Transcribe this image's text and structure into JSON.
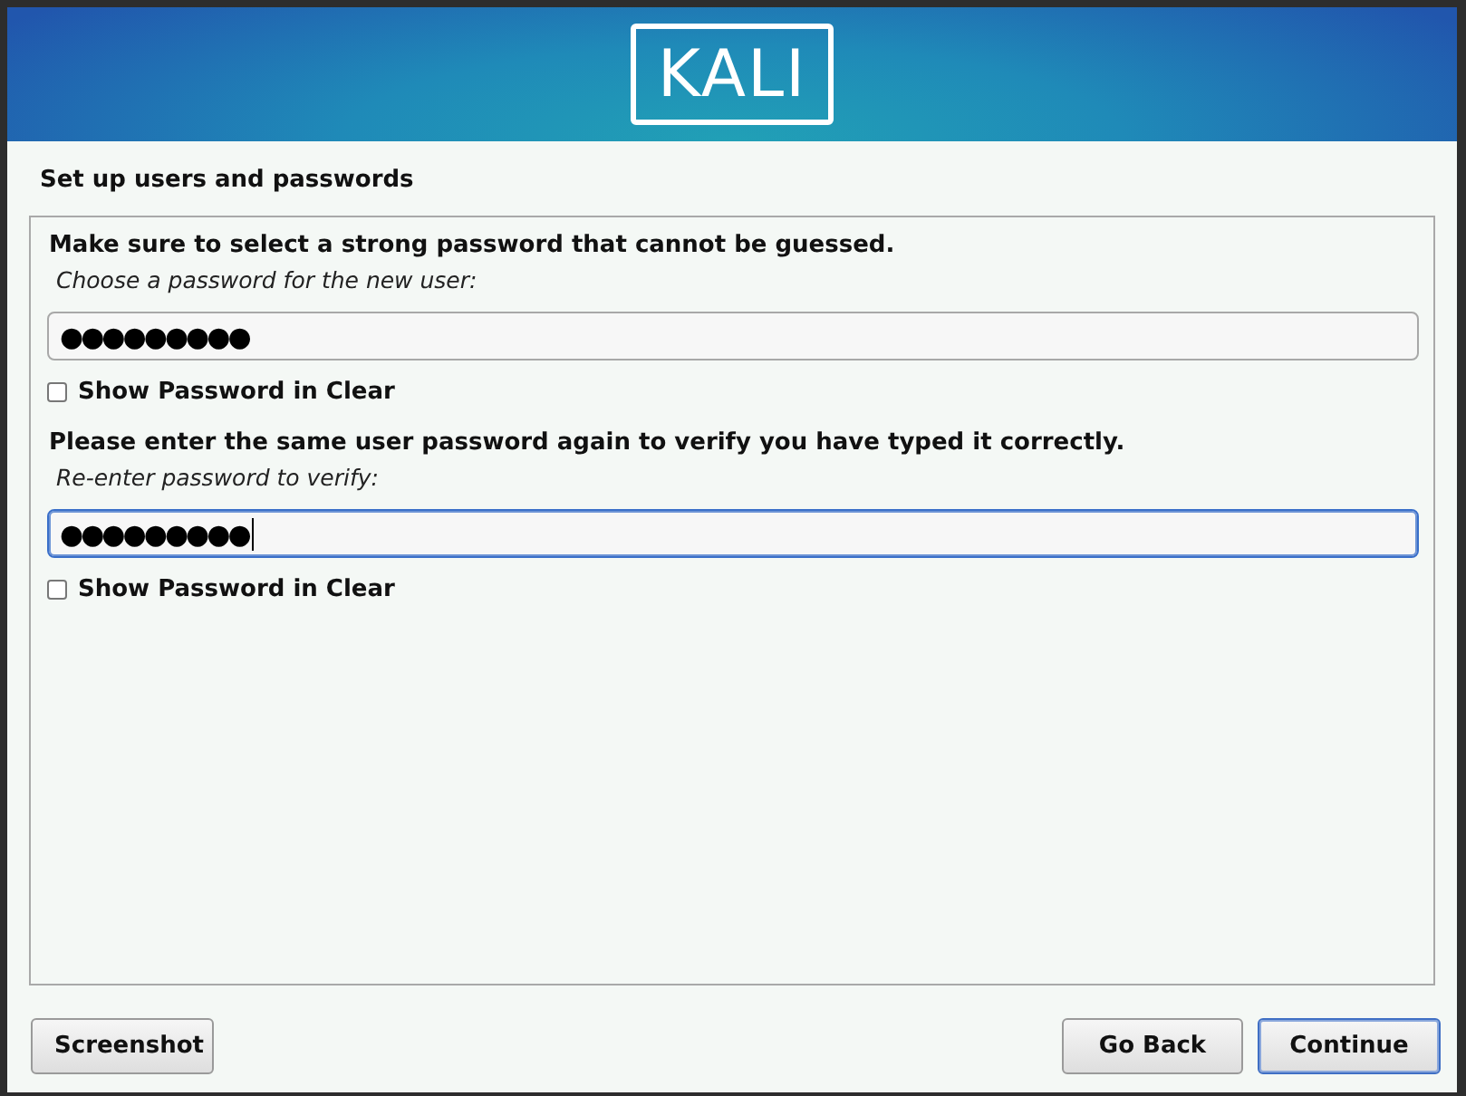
{
  "banner": {
    "logo": "KALI"
  },
  "heading": "Set up users and passwords",
  "sections": [
    {
      "intro": "Make sure to select a strong password that cannot be guessed.",
      "prompt": "Choose a password for the new user:",
      "value": "●●●●●●●●●",
      "focused": false,
      "toggle": {
        "label": "Show Password in Clear",
        "checked": false
      }
    },
    {
      "intro": "Please enter the same user password again to verify you have typed it correctly.",
      "prompt": "Re-enter password to verify:",
      "value": "●●●●●●●●●",
      "focused": true,
      "toggle": {
        "label": "Show Password in Clear",
        "checked": false
      }
    }
  ],
  "buttons": [
    {
      "label": "Screenshot",
      "default": false
    },
    {
      "label": "Go Back",
      "default": false
    },
    {
      "label": "Continue",
      "default": true
    }
  ]
}
